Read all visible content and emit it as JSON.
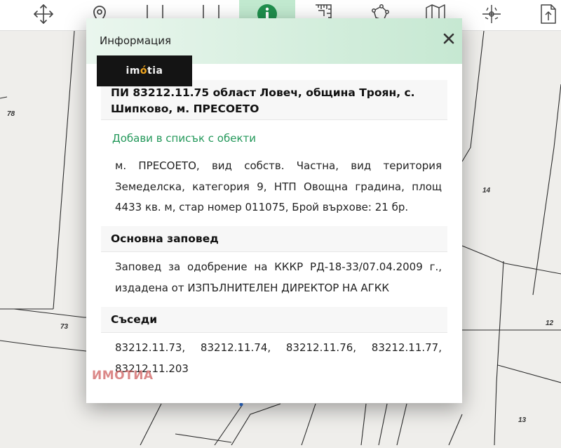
{
  "toolbar": {
    "tools": [
      {
        "icon": "move-arrows-icon"
      },
      {
        "icon": "location-pin-icon"
      },
      {
        "icon": "select-area-icon"
      },
      {
        "icon": "select-rectangle-icon"
      },
      {
        "icon": "info-icon",
        "active": true
      },
      {
        "icon": "ruler-measure-icon"
      },
      {
        "icon": "polygon-measure-icon"
      },
      {
        "icon": "map-layers-icon"
      },
      {
        "icon": "coordinates-grid-icon"
      },
      {
        "icon": "export-icon"
      }
    ]
  },
  "map": {
    "parcel_labels": [
      "78",
      "14",
      "73",
      "12",
      "13"
    ]
  },
  "popup": {
    "title": "Информация",
    "close_label": "×",
    "logo_text": "imotia",
    "parcel_title": "ПИ 83212.11.75 област Ловеч, община Троян, с. Шипково, м. ПРЕСОЕТО",
    "add_link": "Добави в списък с обекти",
    "details": "м. ПРЕСОЕТО, вид собств. Частна, вид територия Земеделска, категория 9, НТП Овощна градина, площ 4433 кв. м, стар номер 011075, Брой върхове: 21 бр.",
    "order_heading": "Основна заповед",
    "order_text": "Заповед за одобрение на КККР РД-18-33/07.04.2009 г., издадена от ИЗПЪЛНИТЕЛЕН ДИРЕКТОР НА АГКК",
    "neighbors_heading": "Съседи",
    "neighbors_text": "83212.11.73, 83212.11.74, 83212.11.76, 83212.11.77, 83212.11.203",
    "watermark": "ИМОТИА"
  },
  "colors": {
    "active_tool": "#c2ead0",
    "link": "#23985a",
    "header_green": "#d4eedd",
    "watermark": "#cd5a5a"
  }
}
